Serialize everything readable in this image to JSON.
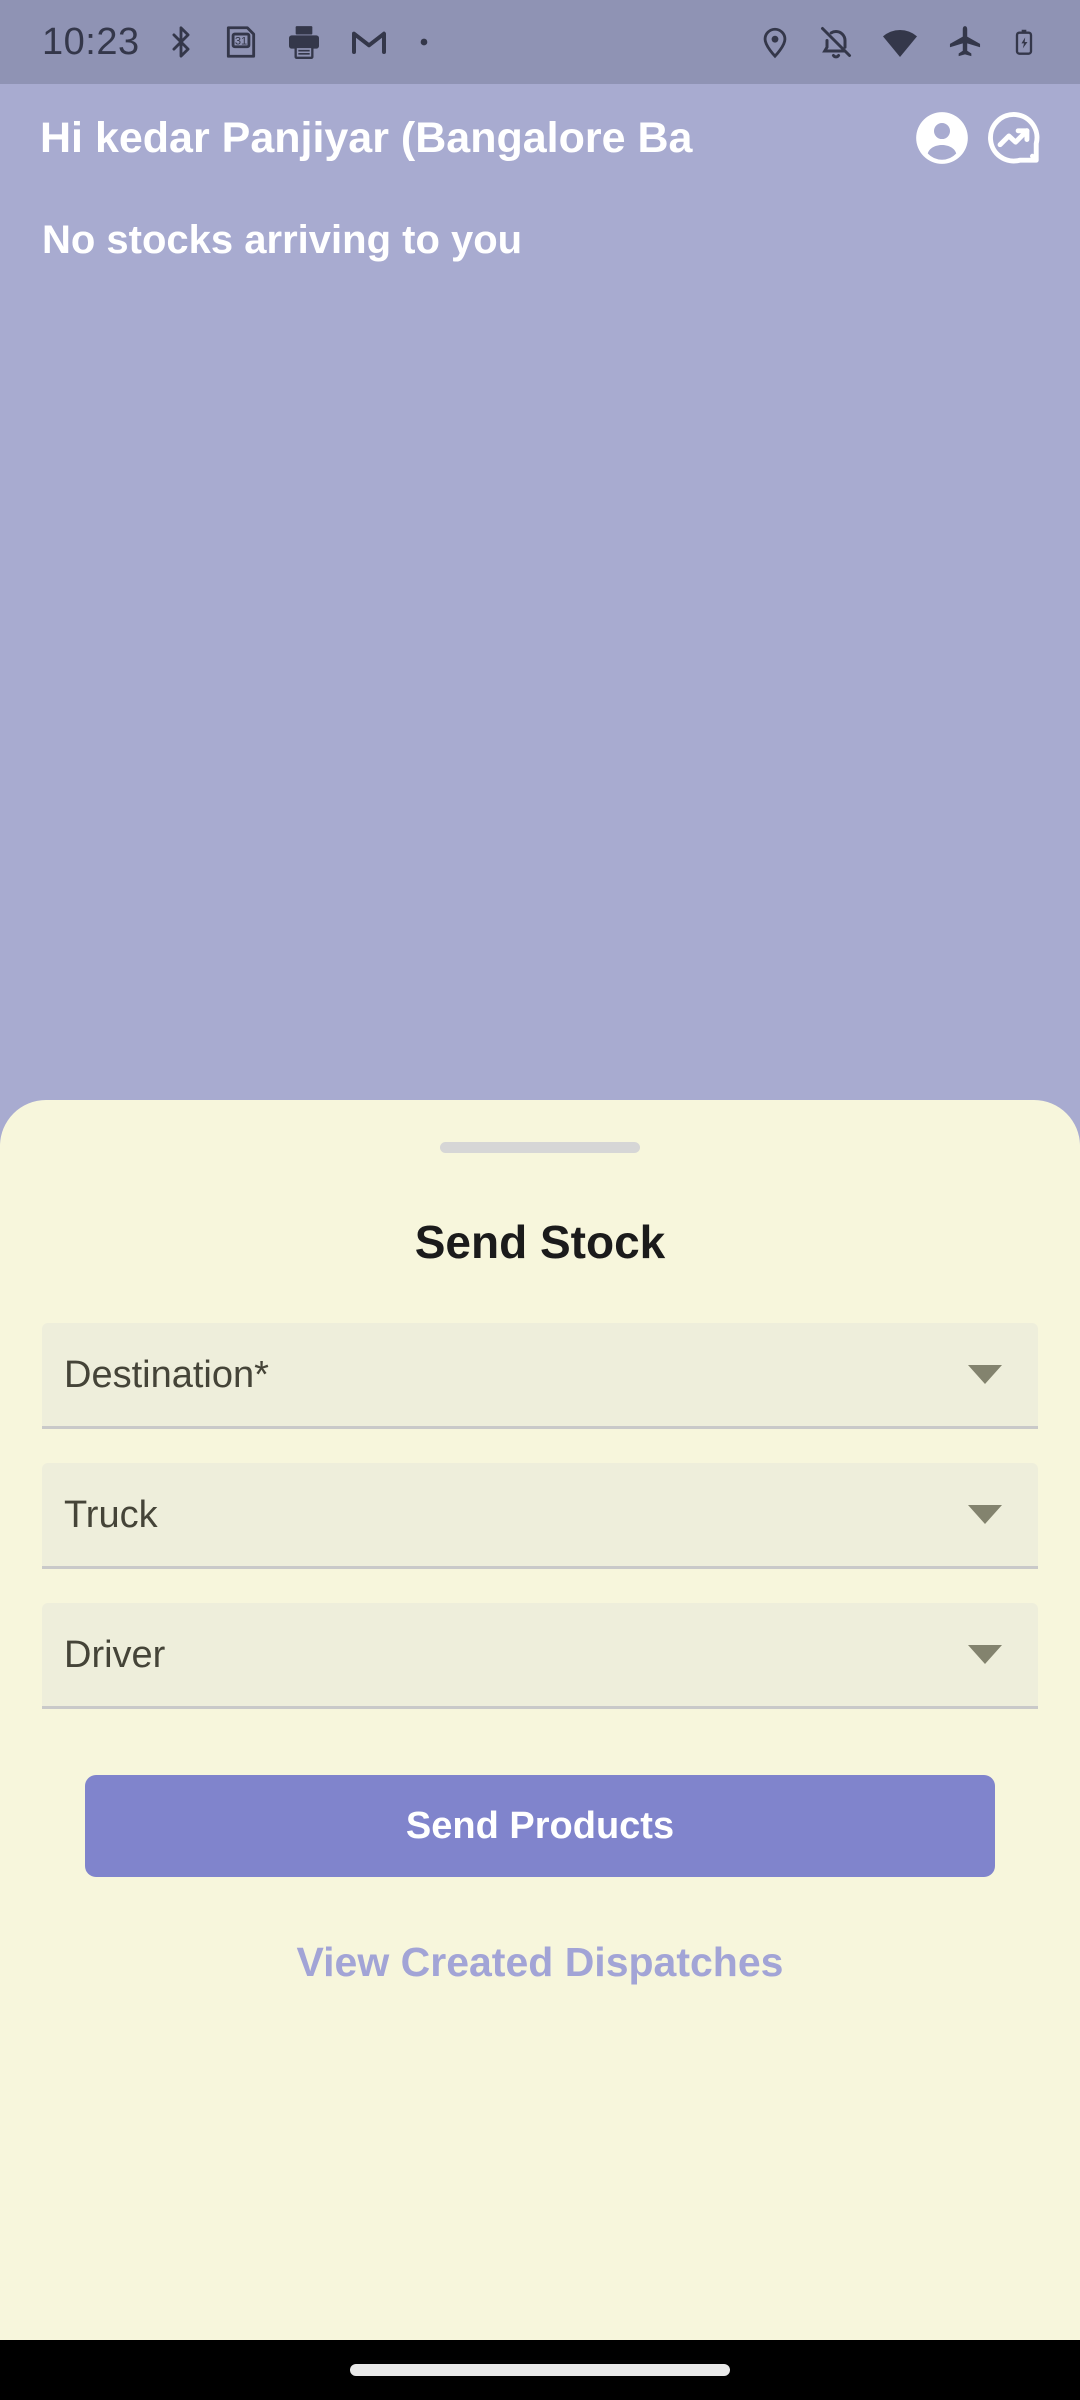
{
  "status_bar": {
    "time": "10:23",
    "left_icons": [
      {
        "name": "bluetooth-icon",
        "label": "Bluetooth"
      },
      {
        "name": "calendar-icon",
        "label": "31"
      },
      {
        "name": "printer-icon",
        "label": "Printer"
      },
      {
        "name": "gmail-icon",
        "label": "M"
      },
      {
        "name": "dot-icon",
        "label": "•"
      }
    ],
    "right_icons": [
      {
        "name": "location-pin-icon",
        "label": "Location"
      },
      {
        "name": "notifications-off-icon",
        "label": "Silent"
      },
      {
        "name": "wifi-icon",
        "label": "Wi-Fi"
      },
      {
        "name": "airplane-mode-icon",
        "label": "Airplane mode"
      },
      {
        "name": "battery-charging-icon",
        "label": "Battery charging"
      }
    ]
  },
  "header": {
    "title": "Hi kedar Panjiyar (Bangalore Ba",
    "account_icon": "account-circle-icon",
    "analytics_icon": "monitoring-trend-icon"
  },
  "main": {
    "empty_state_text": "No stocks arriving to you"
  },
  "sheet": {
    "title": "Send Stock",
    "fields": [
      {
        "label": "Destination*",
        "name": "destination",
        "value": "",
        "caret": "chevron-down-icon"
      },
      {
        "label": "Truck",
        "name": "truck",
        "value": "",
        "caret": "chevron-down-icon"
      },
      {
        "label": "Driver",
        "name": "driver",
        "value": "",
        "caret": "chevron-down-icon"
      }
    ],
    "primary_button": "Send Products",
    "secondary_link": "View Created Dispatches"
  },
  "colors": {
    "background_purple": "#a8abd0",
    "status_bar": "#8f93b4",
    "sheet_cream": "#f7f6dc",
    "field_fill": "#eeeedb",
    "accent_purple": "#8084cc",
    "link_purple": "#a2a4d6",
    "caret_grey": "#83836e"
  }
}
